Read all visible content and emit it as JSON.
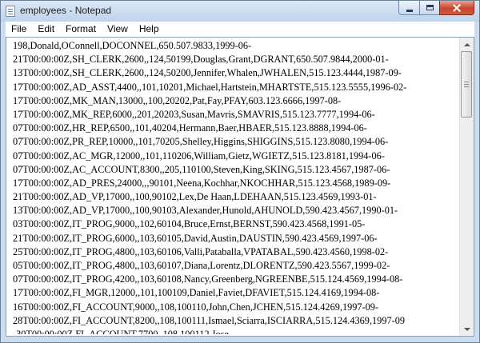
{
  "window": {
    "title": "employees - Notepad"
  },
  "menu": {
    "items": [
      "File",
      "Edit",
      "Format",
      "View",
      "Help"
    ]
  },
  "editor": {
    "lines": [
      "198,Donald,OConnell,DOCONNEL,650.507.9833,1999-06-",
      "21T00:00:00Z,SH_CLERK,2600,,124,50199,Douglas,Grant,DGRANT,650.507.9844,2000-01-",
      "13T00:00:00Z,SH_CLERK,2600,,124,50200,Jennifer,Whalen,JWHALEN,515.123.4444,1987-09-",
      "17T00:00:00Z,AD_ASST,4400,,101,10201,Michael,Hartstein,MHARTSTE,515.123.5555,1996-02-",
      "17T00:00:00Z,MK_MAN,13000,,100,20202,Pat,Fay,PFAY,603.123.6666,1997-08-",
      "17T00:00:00Z,MK_REP,6000,,201,20203,Susan,Mavris,SMAVRIS,515.123.7777,1994-06-",
      "07T00:00:00Z,HR_REP,6500,,101,40204,Hermann,Baer,HBAER,515.123.8888,1994-06-",
      "07T00:00:00Z,PR_REP,10000,,101,70205,Shelley,Higgins,SHIGGINS,515.123.8080,1994-06-",
      "07T00:00:00Z,AC_MGR,12000,,101,110206,William,Gietz,WGIETZ,515.123.8181,1994-06-",
      "07T00:00:00Z,AC_ACCOUNT,8300,,205,110100,Steven,King,SKING,515.123.4567,1987-06-",
      "17T00:00:00Z,AD_PRES,24000,,,90101,Neena,Kochhar,NKOCHHAR,515.123.4568,1989-09-",
      "21T00:00:00Z,AD_VP,17000,,100,90102,Lex,De Haan,LDEHAAN,515.123.4569,1993-01-",
      "13T00:00:00Z,AD_VP,17000,,100,90103,Alexander,Hunold,AHUNOLD,590.423.4567,1990-01-",
      "03T00:00:00Z,IT_PROG,9000,,102,60104,Bruce,Ernst,BERNST,590.423.4568,1991-05-",
      "21T00:00:00Z,IT_PROG,6000,,103,60105,David,Austin,DAUSTIN,590.423.4569,1997-06-",
      "25T00:00:00Z,IT_PROG,4800,,103,60106,Valli,Pataballa,VPATABAL,590.423.4560,1998-02-",
      "05T00:00:00Z,IT_PROG,4800,,103,60107,Diana,Lorentz,DLORENTZ,590.423.5567,1999-02-",
      "07T00:00:00Z,IT_PROG,4200,,103,60108,Nancy,Greenberg,NGREENBE,515.124.4569,1994-08-",
      "17T00:00:00Z,FI_MGR,12000,,101,100109,Daniel,Faviet,DFAVIET,515.124.4169,1994-08-",
      "16T00:00:00Z,FI_ACCOUNT,9000,,108,100110,John,Chen,JCHEN,515.124.4269,1997-09-",
      "28T00:00:00Z,FI_ACCOUNT,8200,,108,100111,Ismael,Sciarra,ISCIARRA,515.124.4369,1997-09",
      "-30T00:00:00Z,FI_ACCOUNT,7700,,108,100112,Jose"
    ]
  }
}
